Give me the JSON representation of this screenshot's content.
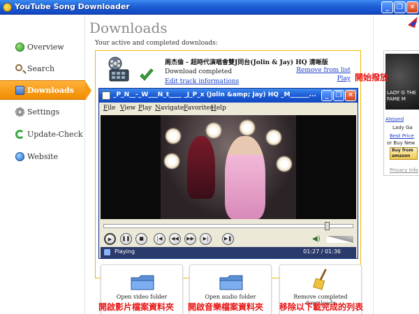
{
  "window": {
    "title": "YouTube Song Downloader"
  },
  "sidebar": {
    "items": [
      {
        "label": "Overview",
        "icon": "overview-icon"
      },
      {
        "label": "Search",
        "icon": "search-icon"
      },
      {
        "label": "Downloads",
        "icon": "downloads-icon",
        "active": true
      },
      {
        "label": "Settings",
        "icon": "settings-icon"
      },
      {
        "label": "Update-Check",
        "icon": "update-icon"
      },
      {
        "label": "Website",
        "icon": "globe-icon"
      }
    ]
  },
  "main": {
    "title": "Downloads",
    "subtitle": "Your active and completed downloads:",
    "download": {
      "title": "周杰倫 - 超時代演唱會雙J同台(Jolin & Jay) HQ 清晰版",
      "status": "Download completed",
      "track_link": "Edit track informations",
      "remove_link": "Remove from list",
      "play_link": "Play"
    },
    "actions": {
      "open_video": "Open video folder",
      "open_audio": "Open audio folder",
      "remove_completed": "Remove completed downloads"
    }
  },
  "player": {
    "title": "_P_N__-_W___N_t____ _J_P_x (Jolin &amp; Jay) HQ _M______...",
    "menu": [
      "File",
      "View",
      "Play",
      "Navigate",
      "Favorites",
      "Help"
    ],
    "status": "Playing",
    "time": "01:27 / 01:36",
    "progress": 0.906
  },
  "ad": {
    "album_text": "LADY G THE FAME M",
    "artist_link": "Alejand",
    "line2": "Lady Ga",
    "best_price": "Best Price",
    "buy_new": "or Buy New",
    "buy_button": "Buy from amazon",
    "privacy": "Privacy Info"
  },
  "annotations": {
    "start_play": "開始撥放",
    "open_video": "開啟影片檔案資料夾",
    "open_audio": "開啟音樂檔案資料夾",
    "remove_list": "移除以下載完成的列表"
  },
  "colors": {
    "accent_orange": "#f08c00",
    "link_blue": "#1a3ec8",
    "annotation_red": "#e81414",
    "titlebar_blue": "#1f5fd6"
  }
}
